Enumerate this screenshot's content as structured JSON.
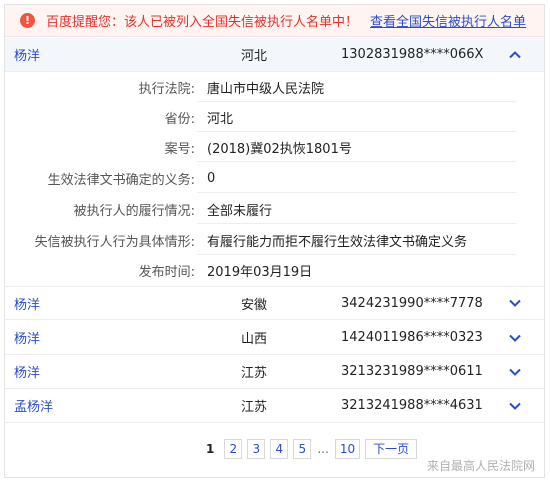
{
  "alert": {
    "icon": "exclamation-icon",
    "text": "百度提醒您：该人已被列入全国失信被执行人名单中！",
    "link": "查看全国失信被执行人名单"
  },
  "expanded_person": {
    "name": "杨洋",
    "province": "河北",
    "id": "1302831988****066X",
    "toggle_icon": "chevron-up-icon",
    "details": [
      {
        "label": "执行法院:",
        "value": "唐山市中级人民法院"
      },
      {
        "label": "省份:",
        "value": "河北"
      },
      {
        "label": "案号:",
        "value": "(2018)冀02执恢1801号"
      },
      {
        "label": "生效法律文书确定的义务:",
        "value": "0"
      },
      {
        "label": "被执行人的履行情况:",
        "value": "全部未履行"
      },
      {
        "label": "失信被执行人行为具体情形:",
        "value": "有履行能力而拒不履行生效法律文书确定义务"
      },
      {
        "label": "发布时间:",
        "value": "2019年03月19日"
      }
    ]
  },
  "persons": [
    {
      "name": "杨洋",
      "province": "安徽",
      "id": "3424231990****7778",
      "toggle_icon": "chevron-down-icon"
    },
    {
      "name": "杨洋",
      "province": "山西",
      "id": "1424011986****0323",
      "toggle_icon": "chevron-down-icon"
    },
    {
      "name": "杨洋",
      "province": "江苏",
      "id": "3213231989****0611",
      "toggle_icon": "chevron-down-icon"
    },
    {
      "name": "孟杨洋",
      "province": "江苏",
      "id": "3213241988****4631",
      "toggle_icon": "chevron-down-icon"
    }
  ],
  "pagination": {
    "current": "1",
    "pages": [
      "2",
      "3",
      "4",
      "5"
    ],
    "ellipsis": "...",
    "last": "10",
    "next": "下一页"
  },
  "source": "来自最高人民法院网",
  "colors": {
    "link": "#2a4ec9",
    "alert_text": "#e1332d",
    "alert_bg": "#fff4f2"
  }
}
